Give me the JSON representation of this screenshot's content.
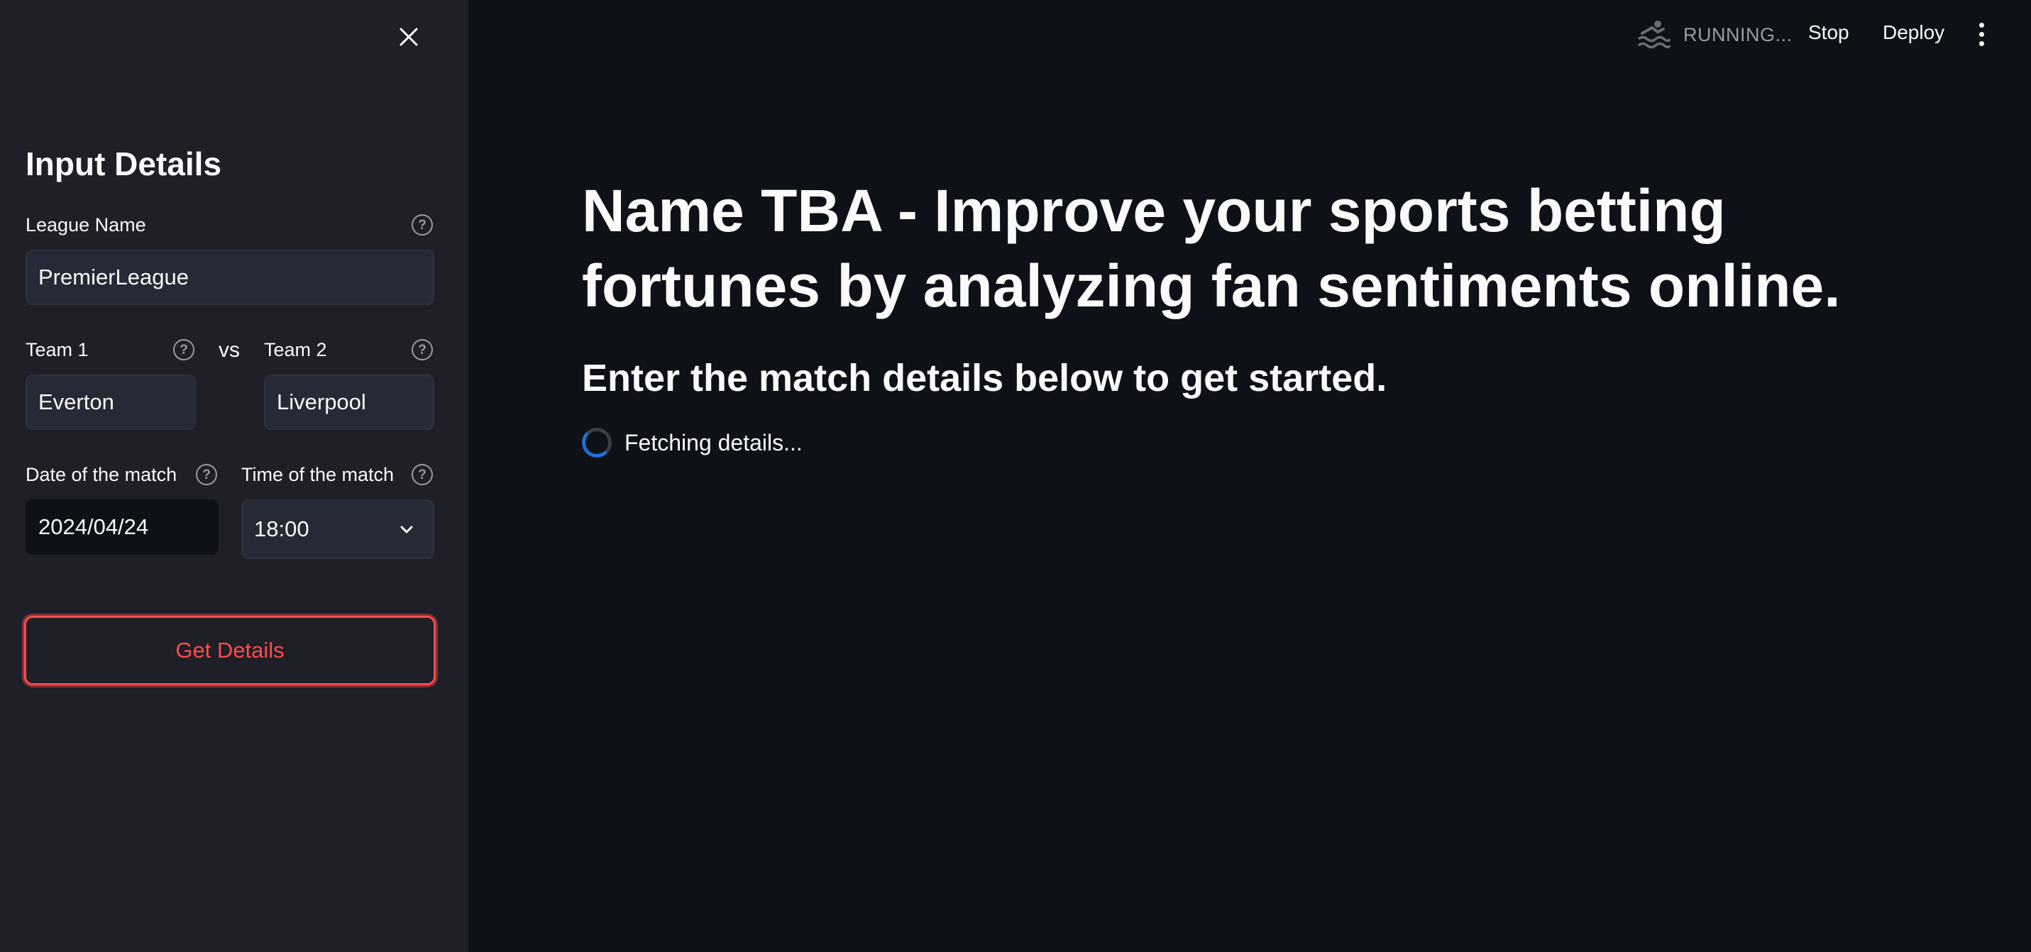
{
  "header": {
    "status": "RUNNING...",
    "stop_label": "Stop",
    "deploy_label": "Deploy"
  },
  "sidebar": {
    "title": "Input Details",
    "league": {
      "label": "League Name",
      "value": "PremierLeague"
    },
    "team1": {
      "label": "Team 1",
      "value": "Everton"
    },
    "vs": "vs",
    "team2": {
      "label": "Team 2",
      "value": "Liverpool"
    },
    "date": {
      "label": "Date of the match",
      "value": "2024/04/24"
    },
    "time": {
      "label": "Time of the match",
      "value": "18:00"
    },
    "button_label": "Get Details",
    "help_glyph": "?"
  },
  "main": {
    "title": "Name TBA - Improve your sports betting fortunes by analyzing fan sentiments online.",
    "subtitle": "Enter the match details below to get started.",
    "status_text": "Fetching details..."
  },
  "colors": {
    "accent": "#ff4b4b",
    "background": "#0e1117",
    "sidebar_bg": "#1e1f27",
    "spinner": "#1f6fd6"
  },
  "icons": [
    "close-icon",
    "swimmer-icon",
    "kebab-menu-icon",
    "help-icon",
    "chevron-down-icon",
    "spinner-icon"
  ]
}
